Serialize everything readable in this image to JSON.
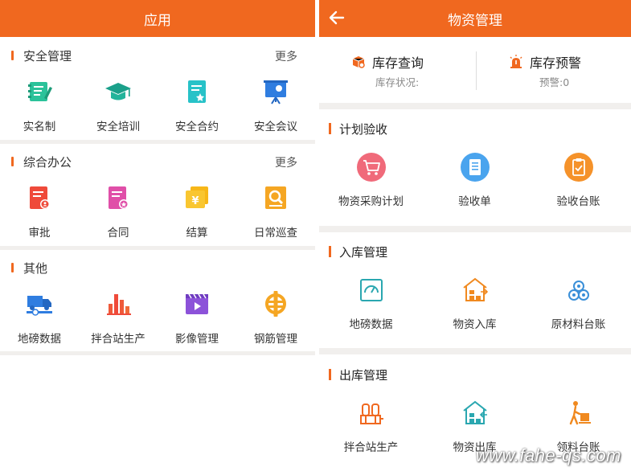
{
  "left": {
    "title": "应用",
    "more_label": "更多",
    "sections": [
      {
        "title": "安全管理",
        "items": [
          {
            "label": "实名制",
            "icon": "id-card-icon"
          },
          {
            "label": "安全培训",
            "icon": "graduation-cap-icon"
          },
          {
            "label": "安全合约",
            "icon": "contract-icon"
          },
          {
            "label": "安全会议",
            "icon": "presentation-board-icon"
          }
        ]
      },
      {
        "title": "综合办公",
        "items": [
          {
            "label": "审批",
            "icon": "approval-doc-icon"
          },
          {
            "label": "合同",
            "icon": "contract-doc-icon"
          },
          {
            "label": "结算",
            "icon": "yen-card-icon"
          },
          {
            "label": "日常巡查",
            "icon": "inspection-search-icon"
          }
        ]
      },
      {
        "title": "其他",
        "items": [
          {
            "label": "地磅数据",
            "icon": "truck-scale-icon"
          },
          {
            "label": "拌合站生产",
            "icon": "bar-chart-icon"
          },
          {
            "label": "影像管理",
            "icon": "video-icon"
          },
          {
            "label": "钢筋管理",
            "icon": "rebar-icon"
          }
        ]
      }
    ]
  },
  "right": {
    "title": "物资管理",
    "stock_query": {
      "title": "库存查询",
      "sub": "库存状况:"
    },
    "stock_alert": {
      "title": "库存预警",
      "sub": "预警:0"
    },
    "sections": [
      {
        "title": "计划验收",
        "items": [
          {
            "label": "物资采购计划",
            "icon": "cart-icon"
          },
          {
            "label": "验收单",
            "icon": "receipt-icon"
          },
          {
            "label": "验收台账",
            "icon": "clipboard-check-icon"
          }
        ]
      },
      {
        "title": "入库管理",
        "items": [
          {
            "label": "地磅数据",
            "icon": "gauge-icon"
          },
          {
            "label": "物资入库",
            "icon": "warehouse-in-icon"
          },
          {
            "label": "原材料台账",
            "icon": "raw-material-icon"
          }
        ]
      },
      {
        "title": "出库管理",
        "items": [
          {
            "label": "拌合站生产",
            "icon": "mixing-plant-icon"
          },
          {
            "label": "物资出库",
            "icon": "warehouse-out-icon"
          },
          {
            "label": "领料台账",
            "icon": "hand-truck-icon"
          }
        ]
      }
    ]
  },
  "watermark": "www.fahe-qs.com",
  "colors": {
    "accent": "#f0681f",
    "separator": "#f1efed"
  }
}
